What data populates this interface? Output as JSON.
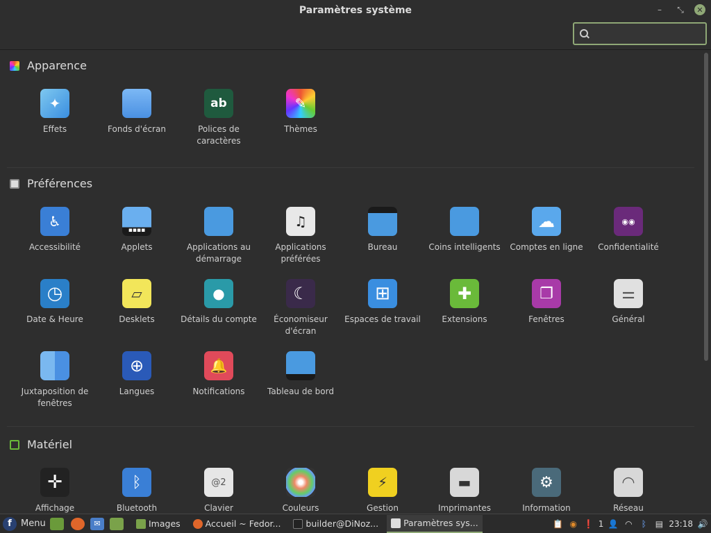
{
  "window": {
    "title": "Paramètres système",
    "min_glyph": "–",
    "restore_glyph": "⤡",
    "close_glyph": "✕"
  },
  "search": {
    "value": "",
    "placeholder": ""
  },
  "sections": [
    {
      "label": "Apparence",
      "items": [
        {
          "label": "Effets",
          "icon": "effects-icon",
          "glyph": "✦"
        },
        {
          "label": "Fonds d'écran",
          "icon": "wallpaper-icon",
          "glyph": ""
        },
        {
          "label": "Polices de caractères",
          "icon": "fonts-icon",
          "glyph": "ab"
        },
        {
          "label": "Thèmes",
          "icon": "themes-icon",
          "glyph": "✎"
        }
      ]
    },
    {
      "label": "Préférences",
      "items": [
        {
          "label": "Accessibilité",
          "icon": "accessibility-icon",
          "glyph": "♿"
        },
        {
          "label": "Applets",
          "icon": "applets-icon",
          "glyph": "▪▪▪▪"
        },
        {
          "label": "Applications au démarrage",
          "icon": "startup-apps-icon",
          "glyph": ""
        },
        {
          "label": "Applications préférées",
          "icon": "preferred-apps-icon",
          "glyph": "♫"
        },
        {
          "label": "Bureau",
          "icon": "desktop-icon",
          "glyph": ""
        },
        {
          "label": "Coins intelligents",
          "icon": "hot-corners-icon",
          "glyph": ""
        },
        {
          "label": "Comptes en ligne",
          "icon": "online-accounts-icon",
          "glyph": "☁"
        },
        {
          "label": "Confidentialité",
          "icon": "privacy-icon",
          "glyph": "◉◉"
        },
        {
          "label": "Date & Heure",
          "icon": "clock-icon",
          "glyph": "◷"
        },
        {
          "label": "Desklets",
          "icon": "desklets-icon",
          "glyph": "▱"
        },
        {
          "label": "Détails du compte",
          "icon": "account-icon",
          "glyph": "●"
        },
        {
          "label": "Économiseur d'écran",
          "icon": "screensaver-icon",
          "glyph": "☾"
        },
        {
          "label": "Espaces de travail",
          "icon": "workspaces-icon",
          "glyph": "⊞"
        },
        {
          "label": "Extensions",
          "icon": "extensions-icon",
          "glyph": "✚"
        },
        {
          "label": "Fenêtres",
          "icon": "windows-icon",
          "glyph": "❐"
        },
        {
          "label": "Général",
          "icon": "general-icon",
          "glyph": "⚌"
        },
        {
          "label": "Juxtaposition de fenêtres",
          "icon": "tiling-icon",
          "glyph": ""
        },
        {
          "label": "Langues",
          "icon": "languages-icon",
          "glyph": "⊕"
        },
        {
          "label": "Notifications",
          "icon": "notifications-icon",
          "glyph": "🔔"
        },
        {
          "label": "Tableau de bord",
          "icon": "panel-icon",
          "glyph": ""
        }
      ]
    },
    {
      "label": "Matériel",
      "items": [
        {
          "label": "Affichage",
          "icon": "display-icon",
          "glyph": "✛"
        },
        {
          "label": "Bluetooth",
          "icon": "bluetooth-icon",
          "glyph": "ᛒ"
        },
        {
          "label": "Clavier",
          "icon": "keyboard-icon",
          "glyph": "@2"
        },
        {
          "label": "Couleurs",
          "icon": "colors-icon",
          "glyph": "✿"
        },
        {
          "label": "Gestion",
          "icon": "power-icon",
          "glyph": "⚡"
        },
        {
          "label": "Imprimantes",
          "icon": "printers-icon",
          "glyph": "▬"
        },
        {
          "label": "Information",
          "icon": "info-icon",
          "glyph": "⚙"
        },
        {
          "label": "Réseau",
          "icon": "network-icon",
          "glyph": "◠"
        }
      ]
    }
  ],
  "taskbar": {
    "menu_label": "Menu",
    "menu_glyph": "f",
    "windows": [
      {
        "label": "Images",
        "icon": "folder-icon"
      },
      {
        "label": "Accueil ~ Fedor...",
        "icon": "firefox-icon"
      },
      {
        "label": "builder@DiNoz...",
        "icon": "terminal-icon"
      },
      {
        "label": "Paramètres sys...",
        "icon": "settings-icon",
        "active": true
      }
    ],
    "tray_count": "1",
    "clock": "23:18"
  },
  "colors": {
    "accent": "#8fa876",
    "background": "#2e2e2e",
    "taskbar": "#2b2b2b"
  }
}
